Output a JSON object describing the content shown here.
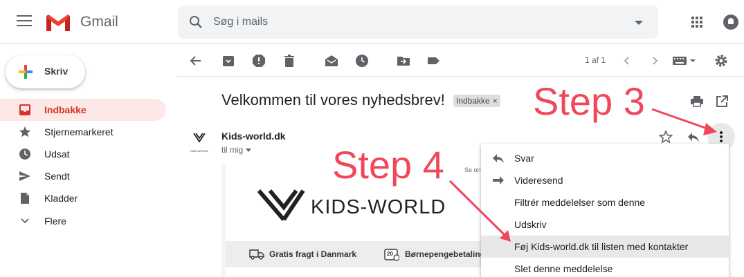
{
  "header": {
    "brand": "Gmail",
    "search_placeholder": "Søg i mails"
  },
  "sidebar": {
    "compose_label": "Skriv",
    "items": [
      {
        "label": "Indbakke",
        "icon": "inbox-icon",
        "active": true
      },
      {
        "label": "Stjernemarkeret",
        "icon": "star-icon"
      },
      {
        "label": "Udsat",
        "icon": "clock-icon"
      },
      {
        "label": "Sendt",
        "icon": "send-icon"
      },
      {
        "label": "Kladder",
        "icon": "draft-icon"
      },
      {
        "label": "Flere",
        "icon": "chevron-down-icon"
      }
    ]
  },
  "toolbar": {
    "page_count": "1 af 1"
  },
  "message": {
    "subject": "Velkommen til vores nyhedsbrev!",
    "label_chip": "Indbakke",
    "label_close": "×",
    "sender": "Kids-world.dk",
    "recipient": "til mig",
    "avatar_text": "KIDS-WORLD",
    "body": {
      "see_online": "Se online",
      "logo_text": "KIDS-WORLD",
      "benefit1": "Gratis fragt i Danmark",
      "benefit2": "Børnepengebetaling",
      "badge": "20"
    }
  },
  "context_menu": {
    "items": [
      {
        "label": "Svar",
        "icon": "reply-icon"
      },
      {
        "label": "Videresend",
        "icon": "forward-icon"
      },
      {
        "label": "Filtrér meddelelser som denne"
      },
      {
        "label": "Udskriv"
      },
      {
        "label": "Føj Kids-world.dk til listen med kontakter",
        "highlighted": true
      },
      {
        "label": "Slet denne meddelelse"
      }
    ]
  },
  "annotations": {
    "step3": "Step 3",
    "step4": "Step 4"
  },
  "colors": {
    "accent_red": "#d93025",
    "active_bg": "#fce8e6",
    "annotation": "#f0475a",
    "highlight": "#e8e8e8"
  }
}
